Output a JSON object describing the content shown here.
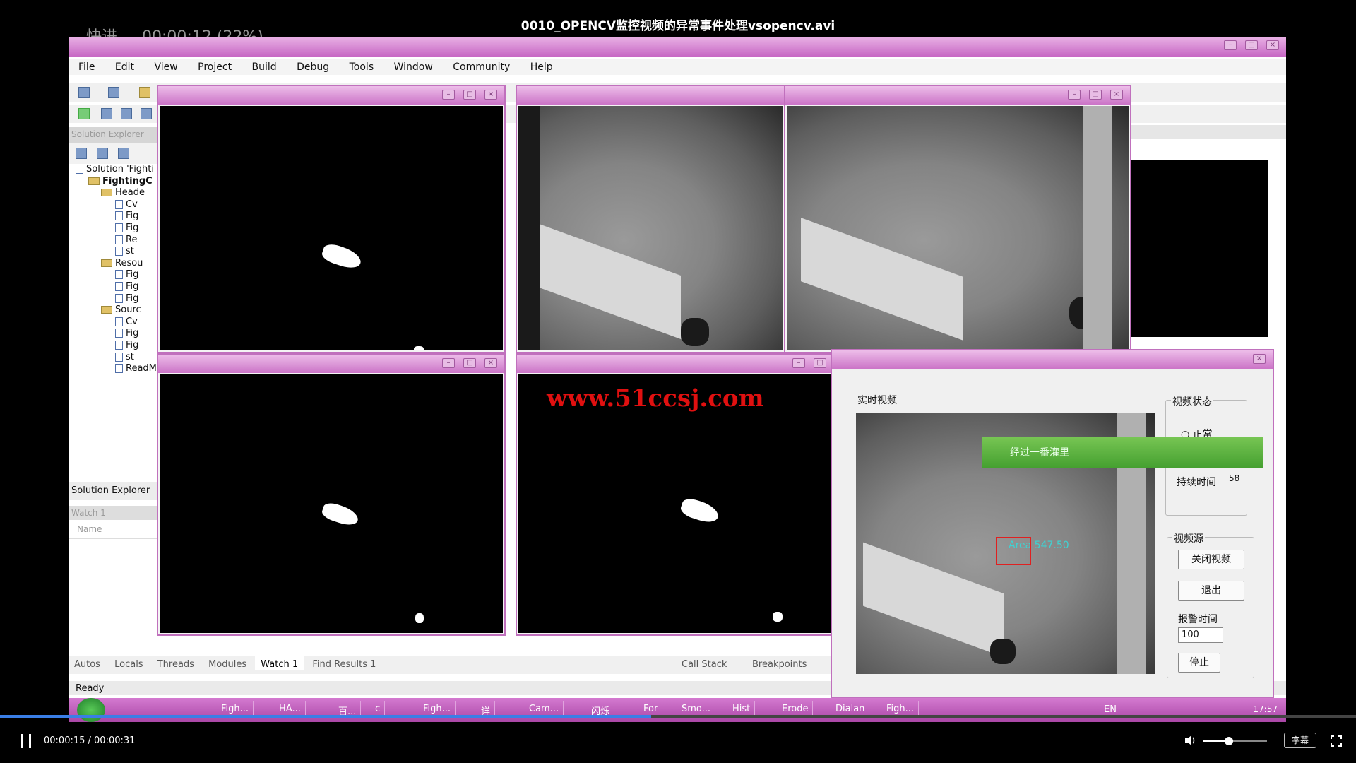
{
  "player": {
    "title": "0010_OPENCV监控视频的异常事件处理vsopencv.avi",
    "osd_mode": "快进",
    "osd_time": "00:00:12 (22%)",
    "current_time": "00:00:15",
    "total_time": "00:00:31",
    "timecode": "00:00:15 / 00:00:31",
    "progress_fraction": 0.48,
    "volume_fraction": 0.4,
    "subtitle_label": "字幕"
  },
  "ide": {
    "menu": [
      "File",
      "Edit",
      "View",
      "Project",
      "Build",
      "Debug",
      "Tools",
      "Window",
      "Community",
      "Help"
    ],
    "solution_explorer": {
      "items": [
        {
          "label": "Solution 'Fighti",
          "kind": "solution"
        },
        {
          "label": "FightingC",
          "kind": "project"
        },
        {
          "label": "Heade",
          "kind": "folder"
        },
        {
          "label": "Cv",
          "kind": "file"
        },
        {
          "label": "Fig",
          "kind": "file"
        },
        {
          "label": "Fig",
          "kind": "file"
        },
        {
          "label": "Re",
          "kind": "file"
        },
        {
          "label": "st",
          "kind": "file"
        },
        {
          "label": "Resou",
          "kind": "folder"
        },
        {
          "label": "Fig",
          "kind": "file"
        },
        {
          "label": "Fig",
          "kind": "file"
        },
        {
          "label": "Fig",
          "kind": "file"
        },
        {
          "label": "Sourc",
          "kind": "folder"
        },
        {
          "label": "Cv",
          "kind": "file"
        },
        {
          "label": "Fig",
          "kind": "file"
        },
        {
          "label": "Fig",
          "kind": "file"
        },
        {
          "label": "st",
          "kind": "file"
        },
        {
          "label": "ReadM",
          "kind": "file"
        }
      ],
      "tab_label": "Solution Explorer"
    },
    "watch": {
      "col_name": "Name"
    },
    "bottom_tabs": [
      "Autos",
      "Locals",
      "Threads",
      "Modules",
      "Watch 1",
      "Find Results 1"
    ],
    "bottom_tabs_right": [
      "Call Stack",
      "Breakpoints"
    ],
    "status": "Ready"
  },
  "overlay": {
    "watermark": "www.51ccsj.com"
  },
  "dialog": {
    "realtime_label": "实时视频",
    "video_state_label": "视频状态",
    "normal_label": "正常",
    "duration_label": "持续时间",
    "duration_value": "58",
    "video_source_label": "视频源",
    "close_video_label": "关闭视频",
    "exit_label": "退出",
    "alarm_time_label": "报警时间",
    "alarm_time_value": "100",
    "stop_label": "停止",
    "area_text": "Area 547.50",
    "toast": "经过一番灌里"
  },
  "taskbar": {
    "items": [
      "Figh...",
      "HA...",
      "百...",
      "c",
      "Figh...",
      "详",
      "Cam...",
      "闪烁",
      "For",
      "Smo...",
      "Hist",
      "Erode",
      "Dialan",
      "Figh..."
    ],
    "lang": "EN",
    "clock": "17:57"
  },
  "colors": {
    "title_pink": "#c768c4",
    "progress": "#3a7ee6",
    "toast_green": "#45a030",
    "watermark": "#e01010"
  }
}
